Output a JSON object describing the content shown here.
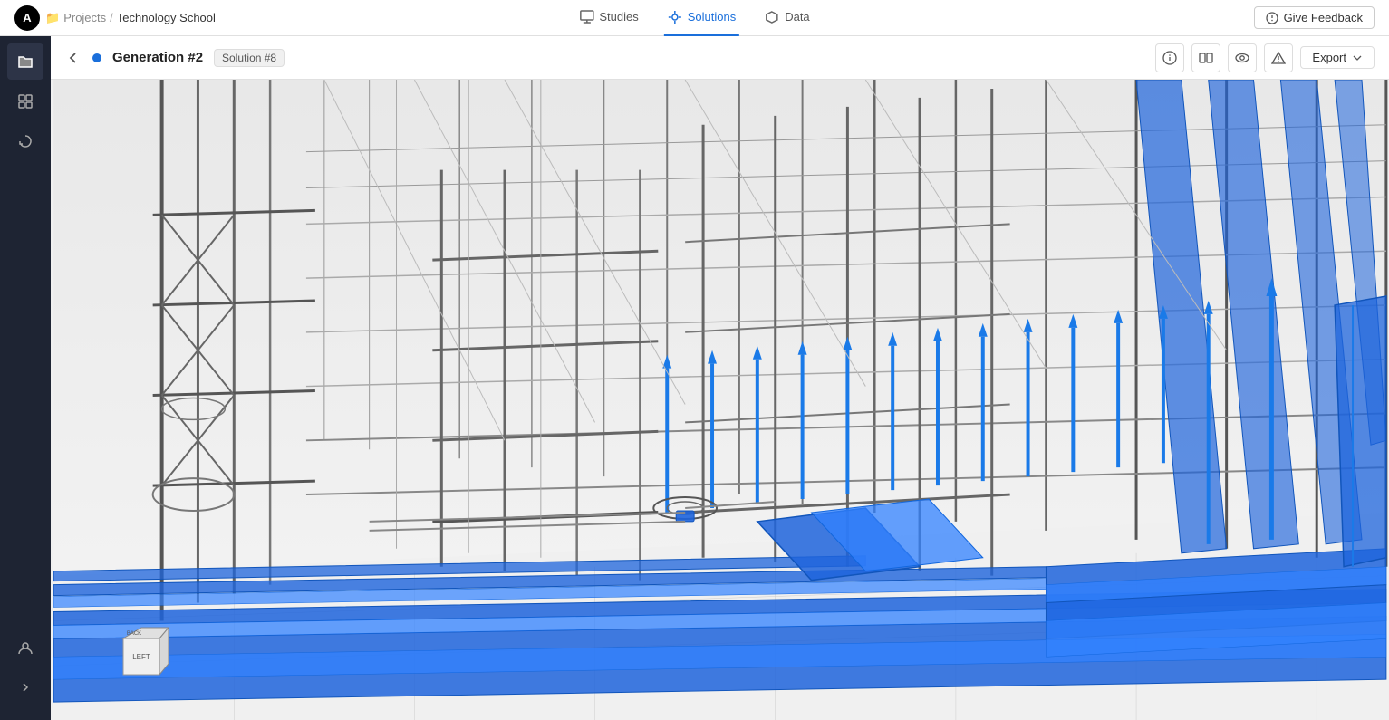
{
  "app": {
    "logo_letter": "A"
  },
  "topnav": {
    "breadcrumb": {
      "projects_label": "Projects",
      "separator": "/",
      "current": "Technology School"
    },
    "tabs": [
      {
        "id": "studies",
        "label": "Studies",
        "active": false
      },
      {
        "id": "solutions",
        "label": "Solutions",
        "active": true
      },
      {
        "id": "data",
        "label": "Data",
        "active": false
      }
    ],
    "feedback_btn": "Give Feedback"
  },
  "subheader": {
    "generation_label": "Generation #2",
    "solution_badge": "Solution #8",
    "info_icon": "ℹ",
    "compare_icon": "⊓",
    "view_icon": "◎",
    "warning_icon": "△",
    "export_label": "Export",
    "export_chevron": "▾"
  },
  "sidebar": {
    "items": [
      {
        "id": "folder",
        "icon": "folder"
      },
      {
        "id": "grid",
        "icon": "grid"
      },
      {
        "id": "refresh",
        "icon": "refresh"
      }
    ],
    "bottom": [
      {
        "id": "user",
        "icon": "user"
      },
      {
        "id": "expand",
        "icon": "expand"
      }
    ]
  },
  "viewport": {
    "description": "3D wireframe view of building with blue MEP routes"
  }
}
